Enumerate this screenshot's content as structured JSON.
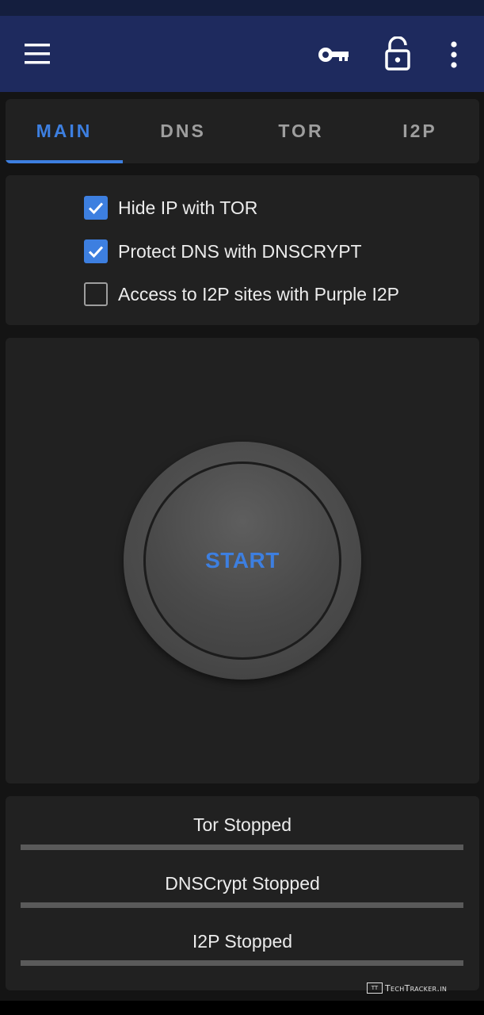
{
  "header": {
    "icons": [
      "menu-icon",
      "key-icon",
      "lock-icon",
      "more-vertical-icon"
    ]
  },
  "tabs": [
    {
      "label": "MAIN",
      "active": true
    },
    {
      "label": "DNS",
      "active": false
    },
    {
      "label": "TOR",
      "active": false
    },
    {
      "label": "I2P",
      "active": false
    }
  ],
  "options": [
    {
      "label": "Hide IP with TOR",
      "checked": true
    },
    {
      "label": "Protect DNS with DNSCRYPT",
      "checked": true
    },
    {
      "label": "Access to I2P sites with Purple I2P",
      "checked": false
    }
  ],
  "control": {
    "start_label": "START"
  },
  "status": [
    {
      "label": "Tor Stopped"
    },
    {
      "label": "DNSCrypt Stopped"
    },
    {
      "label": "I2P Stopped"
    }
  ],
  "watermark": {
    "logo_text": "TT",
    "text": "TechTracker.in"
  },
  "colors": {
    "app_bar": "#1e2a5e",
    "accent": "#3d7fe0",
    "surface": "#212121",
    "background": "#141414"
  }
}
